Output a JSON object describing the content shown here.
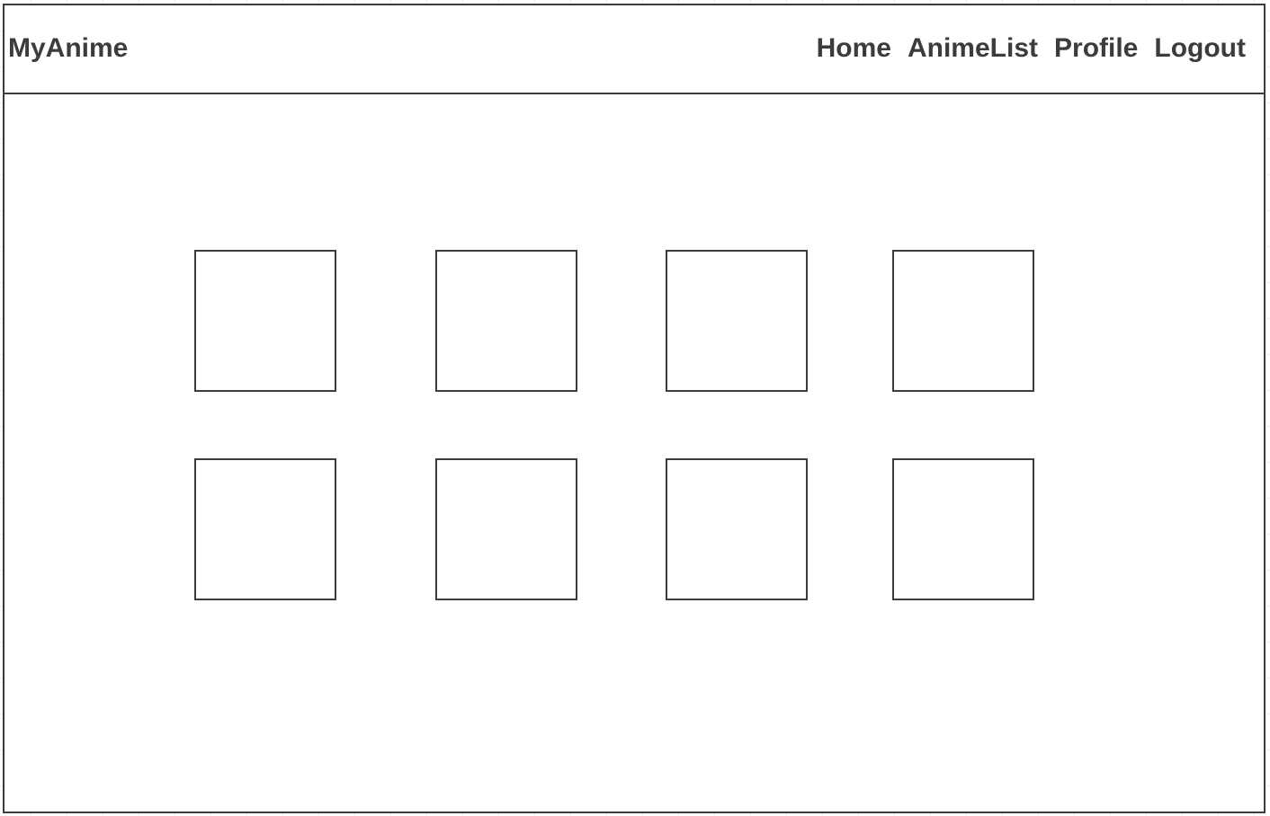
{
  "header": {
    "logo": "MyAnime",
    "nav": {
      "home": "Home",
      "anime_list": "AnimeList",
      "profile": "Profile",
      "logout": "Logout"
    }
  },
  "colors": {
    "stroke": "#3c3c3c",
    "background": "#ffffff",
    "grid": "#eeeeee"
  }
}
